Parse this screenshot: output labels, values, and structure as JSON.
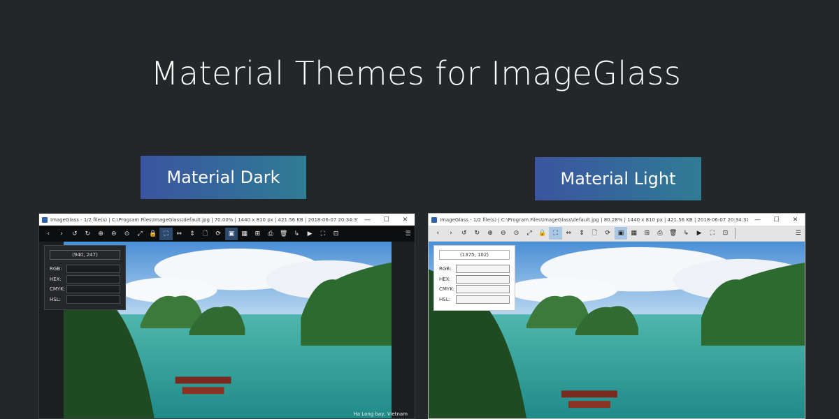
{
  "page": {
    "title": "Material Themes for ImageGlass"
  },
  "themes": {
    "dark": {
      "badge": "Material Dark",
      "window_title": "ImageGlass - 1/2 file(s)  |  C:\\Program Files\\ImageGlass\\default.jpg  |  70.00%  |  1440 x 810 px  |  421.56 KB  |  2018-06-07 20:34:37",
      "coords": "(940, 247)",
      "caption": "Ha Long bay, Vietnam"
    },
    "light": {
      "badge": "Material Light",
      "window_title": "ImageGlass - 1/2 file(s)  |  C:\\Program Files\\ImageGlass\\default.jpg  |  80.28%  |  1440 x 810 px  |  421.56 KB  |  2018-06-07 20:34:37",
      "coords": "(1375, 102)",
      "caption": ""
    }
  },
  "window_controls": {
    "minimize": "—",
    "maximize": "☐",
    "close": "✕"
  },
  "color_picker": {
    "rgb": "RGB:",
    "hex": "HEX:",
    "cmyk": "CMYK:",
    "hsl": "HSL:"
  },
  "toolbar": {
    "icons": {
      "back": "‹",
      "forward": "›",
      "rotate_left": "↺",
      "rotate_right": "↻",
      "zoom_in": "⊕",
      "zoom_out": "⊖",
      "zoom_fit": "⊙",
      "actual_size": "⤢",
      "lock_zoom": "🔒",
      "scale_fit": "⛶",
      "fit_width": "⇔",
      "fit_height": "⇕",
      "open_file": "🗋",
      "refresh": "⟳",
      "color_picker": "▣",
      "thumbnails": "▦",
      "checkerboard": "⊞",
      "print": "⎙",
      "delete": "🗑",
      "goto": "↳",
      "slideshow": "▶",
      "fullscreen": "⛶",
      "frameless": "⊡",
      "menu": "☰"
    },
    "colors": {
      "dark_bg": "#0d0e10",
      "light_bg": "#e4e4e4",
      "dark_active": "#2d4a6e",
      "light_active": "#a9c6e4"
    }
  },
  "colors": {
    "page_bg": "#23272a",
    "badge_gradient_start": "#3a54a0",
    "badge_gradient_end": "#2f7c95"
  }
}
